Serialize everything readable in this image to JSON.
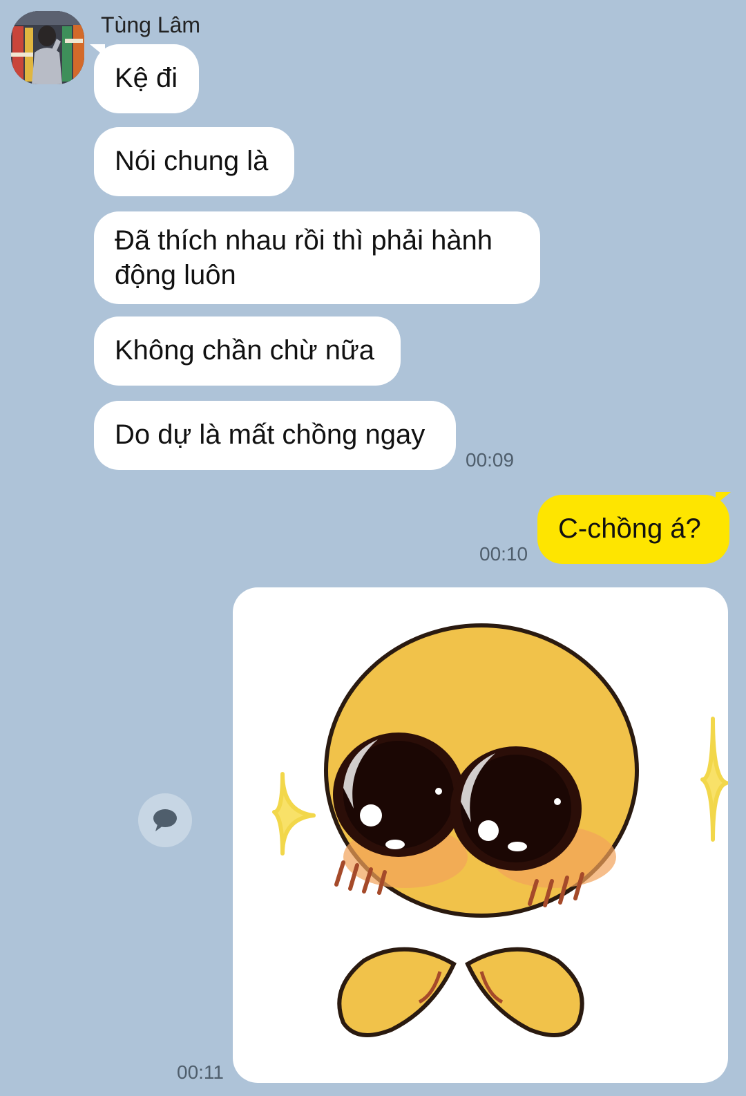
{
  "chat": {
    "sender_name": "Tùng Lâm",
    "incoming": [
      {
        "text": "Kệ đi"
      },
      {
        "text": "Nói chung là"
      },
      {
        "text": "Đã thích nhau rồi thì phải hành động luôn"
      },
      {
        "text": "Không chần chừ nữa"
      },
      {
        "text": "Do dự là mất chồng ngay"
      }
    ],
    "incoming_time": "00:09",
    "outgoing": {
      "text": "C-chồng á?",
      "time": "00:10"
    },
    "sticker": {
      "icon": "cute-emoji-sticker",
      "time": "00:11"
    },
    "icons": {
      "avatar": "profile-photo",
      "reply": "speech-bubble-icon"
    }
  },
  "colors": {
    "background": "#aec3d8",
    "incoming_bubble": "#ffffff",
    "outgoing_bubble": "#fee500"
  }
}
